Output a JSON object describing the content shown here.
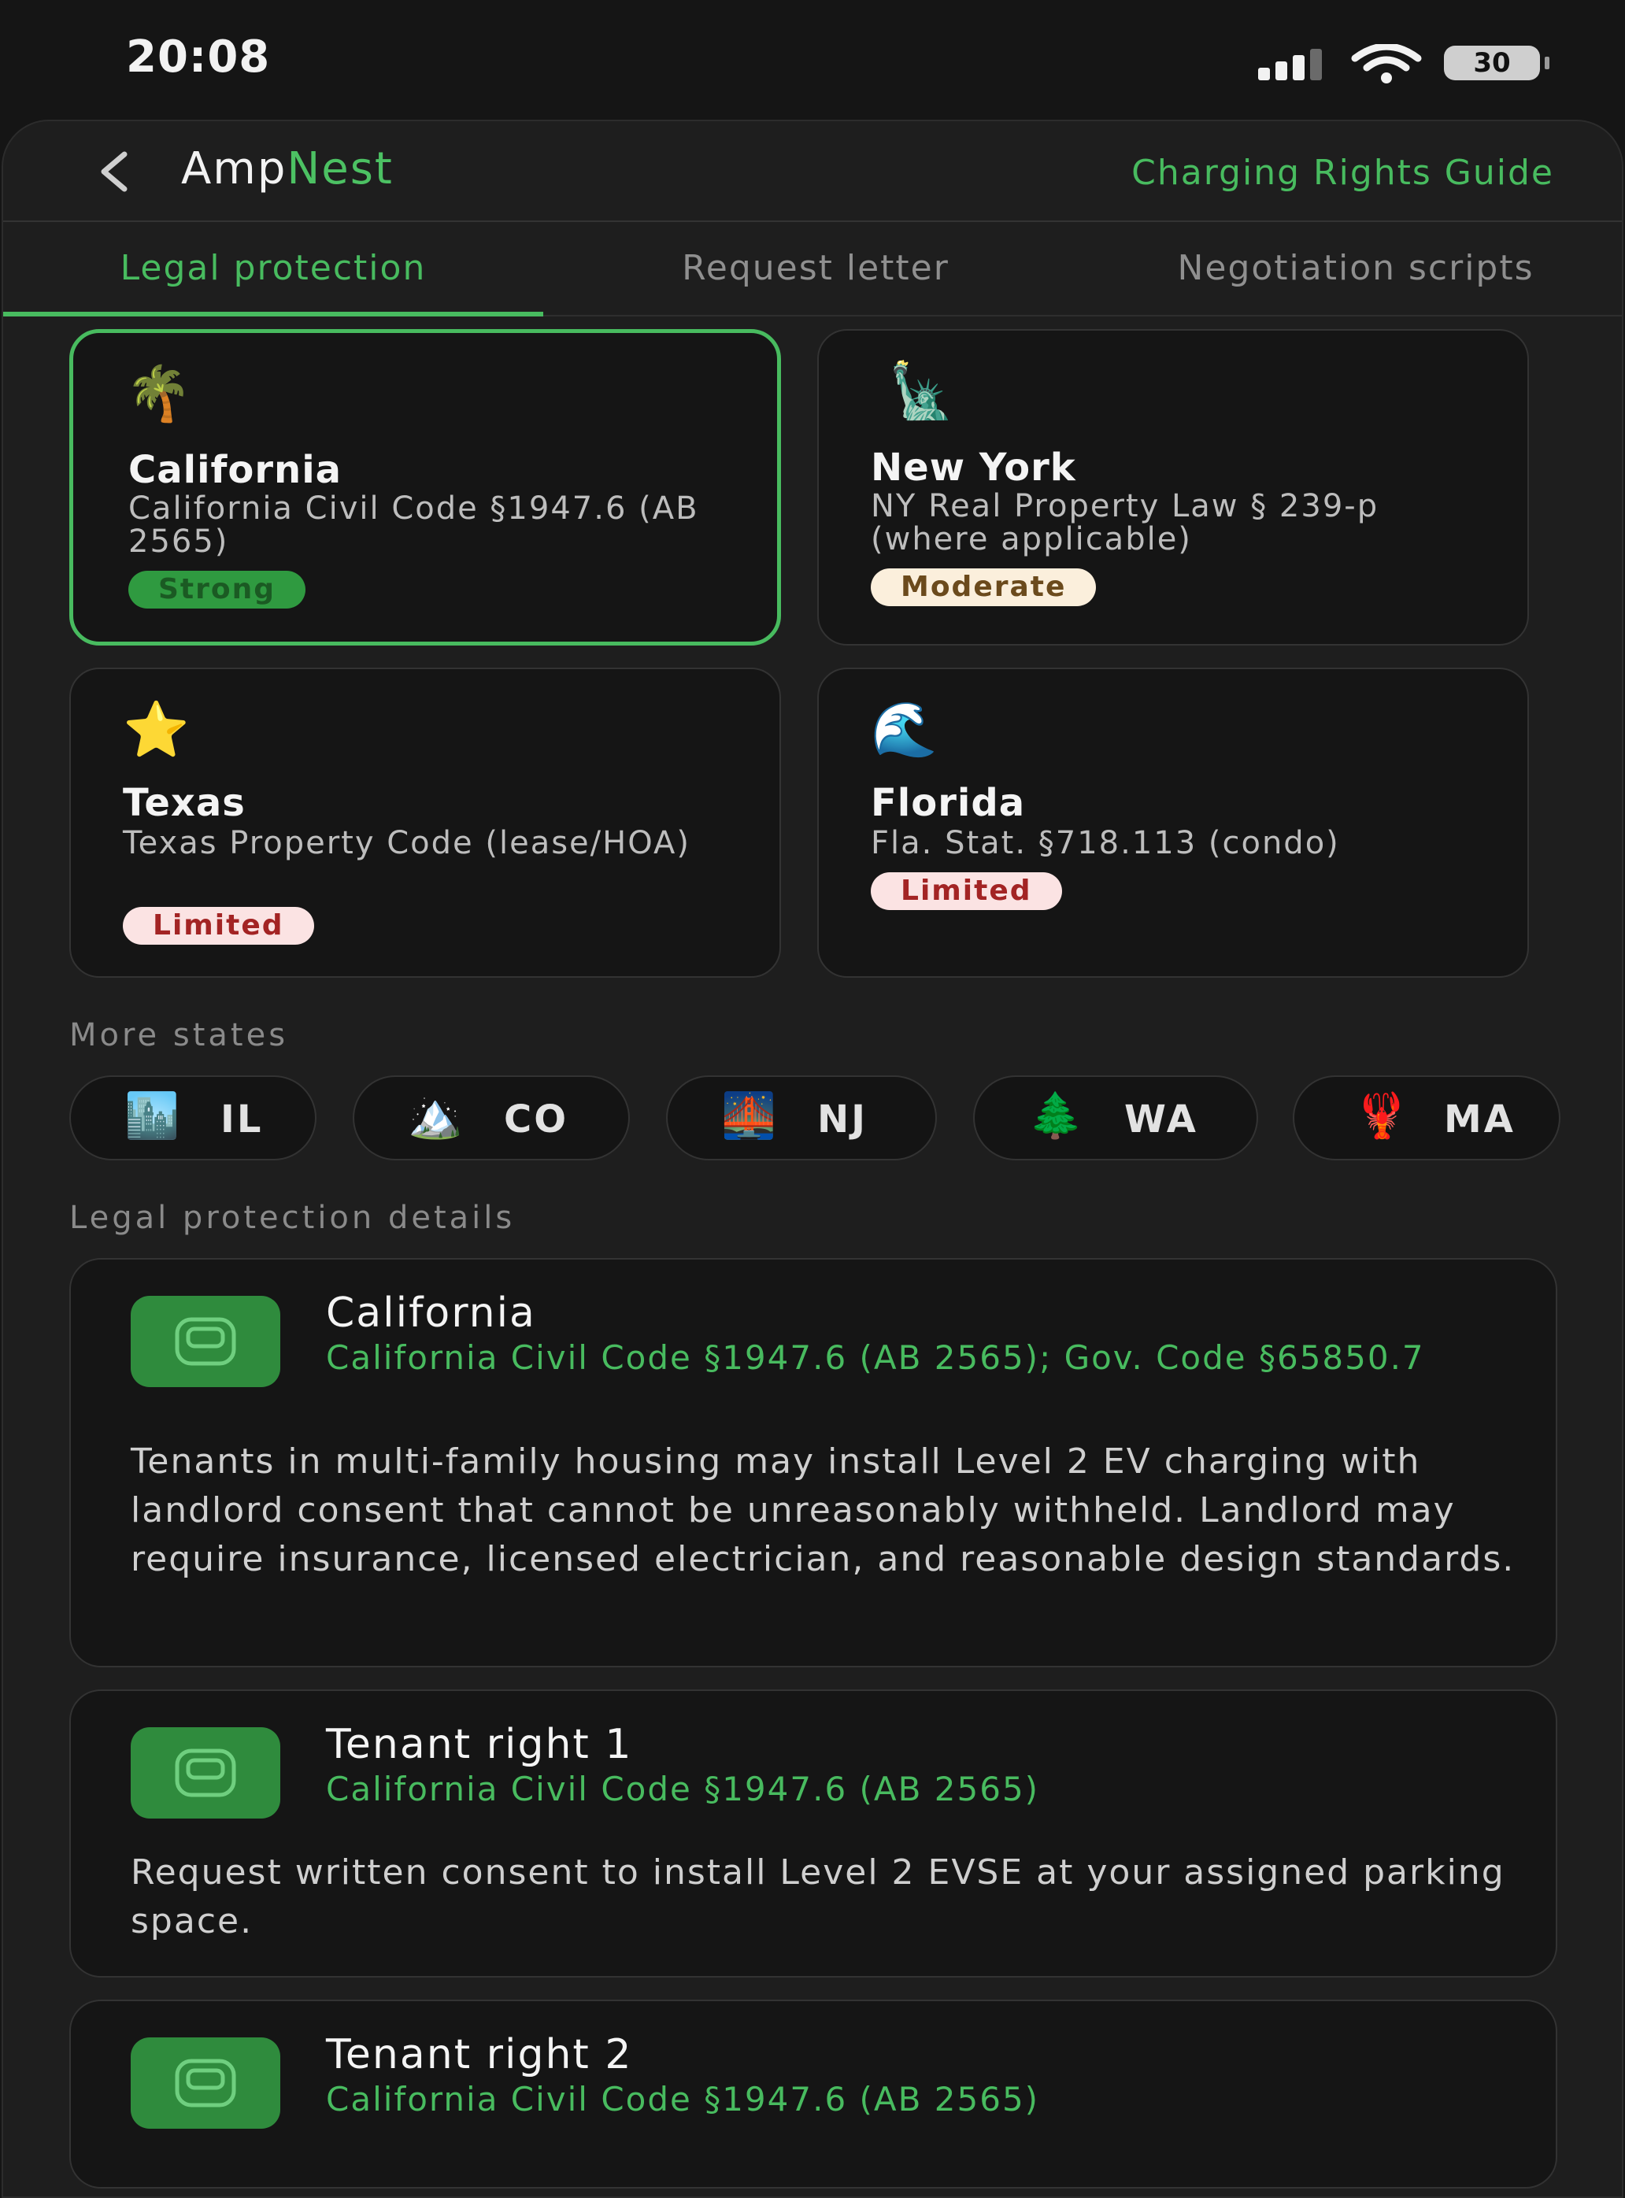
{
  "status_bar": {
    "time": "20:08",
    "battery": "30"
  },
  "header": {
    "brand_part1": "Amp",
    "brand_part2": "Nest",
    "guide_link": "Charging Rights Guide"
  },
  "tabs": [
    {
      "label": "Legal protection",
      "active": true
    },
    {
      "label": "Request letter",
      "active": false
    },
    {
      "label": "Negotiation scripts",
      "active": false
    }
  ],
  "state_cards": [
    {
      "emoji": "🌴",
      "name": "California",
      "code": "California Civil Code §1947.6 (AB 2565)",
      "badge": "Strong",
      "badge_type": "strong",
      "selected": true
    },
    {
      "emoji": "🗽",
      "name": "New York",
      "code": "NY Real Property Law § 239-p (where applicable)",
      "badge": "Moderate",
      "badge_type": "moderate",
      "selected": false
    },
    {
      "emoji": "⭐",
      "name": "Texas",
      "code": "Texas Property Code (lease/HOA)",
      "badge": "Limited",
      "badge_type": "limited",
      "selected": false
    },
    {
      "emoji": "🌊",
      "name": "Florida",
      "code": "Fla. Stat. §718.113 (condo)",
      "badge": "Limited",
      "badge_type": "limited",
      "selected": false
    }
  ],
  "more_states": {
    "title": "More states",
    "chips": [
      {
        "emoji": "🏙️",
        "label": "IL"
      },
      {
        "emoji": "🏔️",
        "label": "CO"
      },
      {
        "emoji": "🌉",
        "label": "NJ"
      },
      {
        "emoji": "🌲",
        "label": "WA"
      },
      {
        "emoji": "🦞",
        "label": "MA"
      }
    ]
  },
  "details": {
    "title": "Legal protection details",
    "items": [
      {
        "title": "California",
        "cite": "California Civil Code §1947.6 (AB 2565); Gov. Code §65850.7",
        "body": "Tenants in multi-family housing may install Level 2 EV charging with landlord consent that cannot be unreasonably withheld. Landlord may require insurance, licensed electrician, and reasonable design standards."
      },
      {
        "title": "Tenant right 1",
        "cite": "California Civil Code §1947.6 (AB 2565)",
        "body": "Request written consent to install Level 2 EVSE at your assigned parking space."
      },
      {
        "title": "Tenant right 2",
        "cite": "California Civil Code §1947.6 (AB 2565)",
        "body": ""
      }
    ]
  },
  "colors": {
    "accent": "#48bb5f",
    "background": "#151515",
    "card": "#151515",
    "icon_bg": "#2f8b3d"
  },
  "icons": {
    "back": "chevron-left-icon",
    "detail": "charger-icon",
    "signal": "signal-icon",
    "wifi": "wifi-icon",
    "battery": "battery-icon"
  }
}
